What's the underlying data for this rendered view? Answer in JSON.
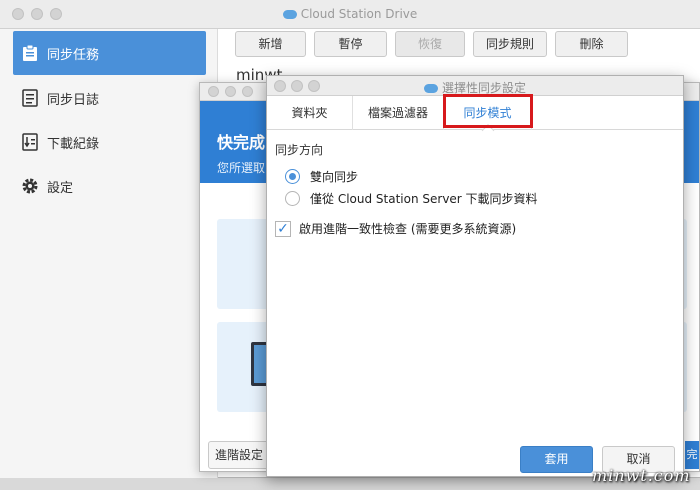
{
  "window": {
    "title": "Cloud Station Drive"
  },
  "sidebar": {
    "items": [
      {
        "label": "同步任務",
        "icon": "clipboard-icon",
        "active": true
      },
      {
        "label": "同步日誌",
        "icon": "log-icon",
        "active": false
      },
      {
        "label": "下載紀錄",
        "icon": "download-log-icon",
        "active": false
      },
      {
        "label": "設定",
        "icon": "gear-icon",
        "active": false
      }
    ]
  },
  "toolbar": {
    "add": "新增",
    "pause": "暫停",
    "resume": "恢復",
    "rules": "同步規則",
    "delete": "刪除"
  },
  "task": {
    "name": "minwt"
  },
  "quick_setup": {
    "title": "快完成",
    "subtitle": "您所選取",
    "advanced_button": "進階設定",
    "next_stub": "完"
  },
  "dialog": {
    "title": "選擇性同步設定",
    "tabs": [
      "資料夾",
      "檔案過濾器",
      "同步模式"
    ],
    "active_tab": "同步模式",
    "section_label": "同步方向",
    "options": [
      {
        "label": "雙向同步",
        "selected": true
      },
      {
        "label": "僅從 Cloud Station Server 下載同步資料",
        "selected": false
      }
    ],
    "consistency_check": {
      "label": "啟用進階一致性檢查 (需要更多系統資源)",
      "checked": true
    },
    "apply": "套用",
    "cancel": "取消"
  },
  "watermark": "minwt.com",
  "colors": {
    "accent": "#4a90d9",
    "highlight": "#d7191c",
    "banner": "#2f7fd4"
  }
}
